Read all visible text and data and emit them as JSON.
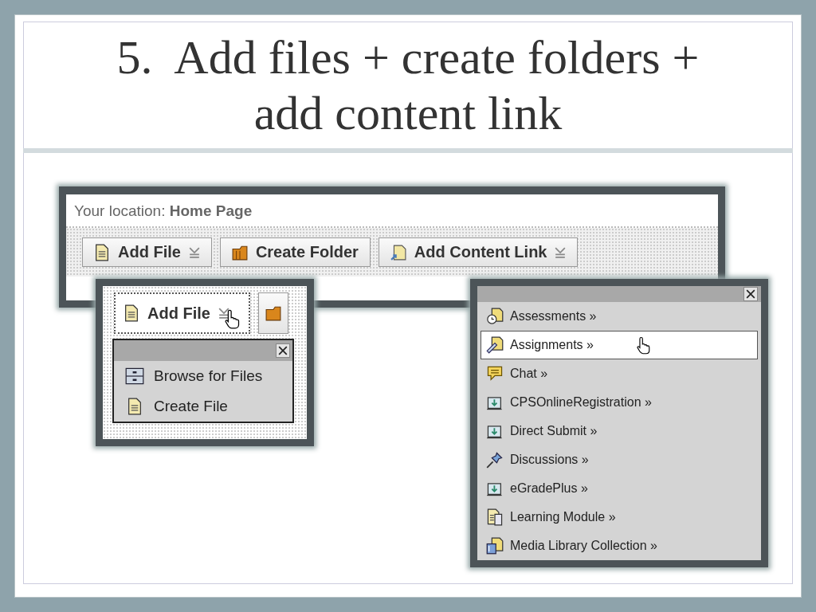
{
  "slide": {
    "title": "5.  Add files + create folders + add content link"
  },
  "location_bar": {
    "text": "Your location: **Home Page**"
  },
  "toolbar": [
    {
      "label": "Add File",
      "kind": "file",
      "dropdown": true
    },
    {
      "label": "Create Folder",
      "kind": "folder",
      "dropdown": false
    },
    {
      "label": "Add Content Link",
      "kind": "link",
      "dropdown": true
    }
  ],
  "add_file_zoom": {
    "buttons": [
      {
        "label": "Add File",
        "kind": "file",
        "dropdown": true,
        "hovered": true
      },
      {
        "kind": "folder",
        "dropdown": false,
        "hovered": false
      }
    ],
    "menu": [
      {
        "label": "Browse for Files",
        "kind": "drawer"
      },
      {
        "label": "Create File",
        "kind": "file"
      }
    ]
  },
  "content_link_menu": [
    {
      "label": "Assessments »",
      "kind": "clock",
      "selected": false
    },
    {
      "label": "Assignments »",
      "kind": "ruler",
      "selected": true
    },
    {
      "label": "Chat »",
      "kind": "chat",
      "selected": false
    },
    {
      "label": "CPSOnlineRegistration »",
      "kind": "submit",
      "selected": false
    },
    {
      "label": "Direct Submit »",
      "kind": "submit",
      "selected": false
    },
    {
      "label": "Discussions »",
      "kind": "pin",
      "selected": false
    },
    {
      "label": "eGradePlus »",
      "kind": "submit",
      "selected": false
    },
    {
      "label": "Learning Module »",
      "kind": "pages",
      "selected": false
    },
    {
      "label": "Media Library Collection »",
      "kind": "media",
      "selected": false
    }
  ]
}
